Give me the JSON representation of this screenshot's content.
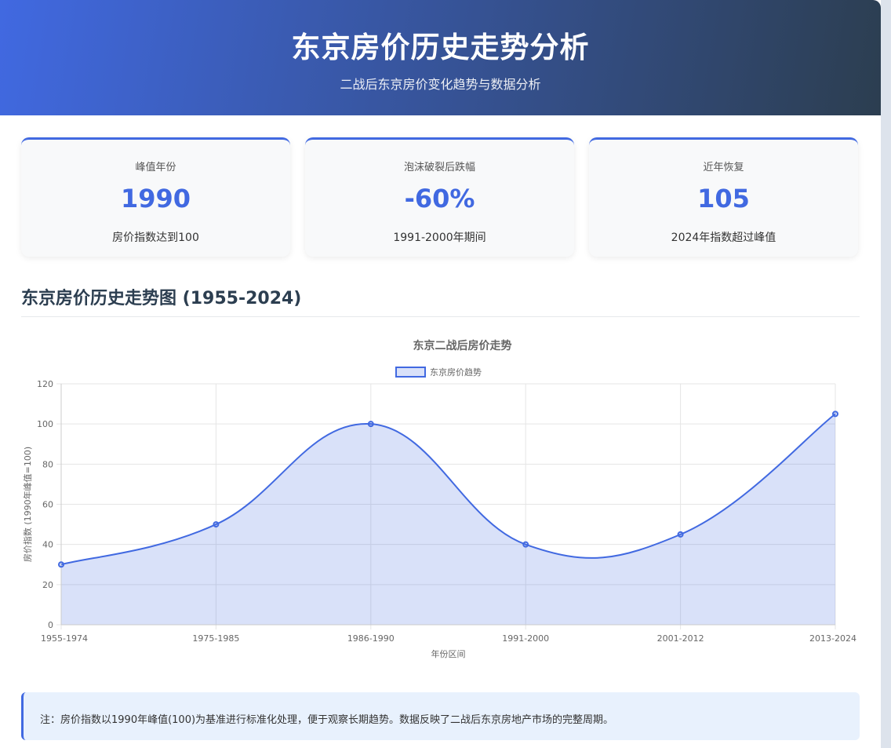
{
  "header": {
    "title": "东京房价历史走势分析",
    "subtitle": "二战后东京房价变化趋势与数据分析"
  },
  "cards": [
    {
      "label": "峰值年份",
      "value": "1990",
      "desc": "房价指数达到100"
    },
    {
      "label": "泡沫破裂后跌幅",
      "value": "-60%",
      "desc": "1991-2000年期间"
    },
    {
      "label": "近年恢复",
      "value": "105",
      "desc": "2024年指数超过峰值"
    }
  ],
  "section": {
    "title": "东京房价历史走势图 (1955-2024)"
  },
  "colors": {
    "accent": "#4169e1",
    "area_fill": "rgba(65,105,225,0.2)",
    "grid": "#e5e5e5"
  },
  "chart_data": {
    "type": "area",
    "title": "东京二战后房价走势",
    "categories": [
      "1955-1974",
      "1975-1985",
      "1986-1990",
      "1991-2000",
      "2001-2012",
      "2013-2024"
    ],
    "series": [
      {
        "name": "东京房价趋势",
        "values": [
          30,
          50,
          100,
          40,
          45,
          105
        ]
      }
    ],
    "xlabel": "年份区间",
    "ylabel": "房价指数 (1990年峰值=100)",
    "ylim": [
      0,
      120
    ],
    "yticks": [
      0,
      20,
      40,
      60,
      80,
      100,
      120
    ],
    "grid": true,
    "legend_position": "top-center"
  },
  "note": {
    "text": "注：房价指数以1990年峰值(100)为基准进行标准化处理，便于观察长期趋势。数据反映了二战后东京房地产市场的完整周期。"
  }
}
